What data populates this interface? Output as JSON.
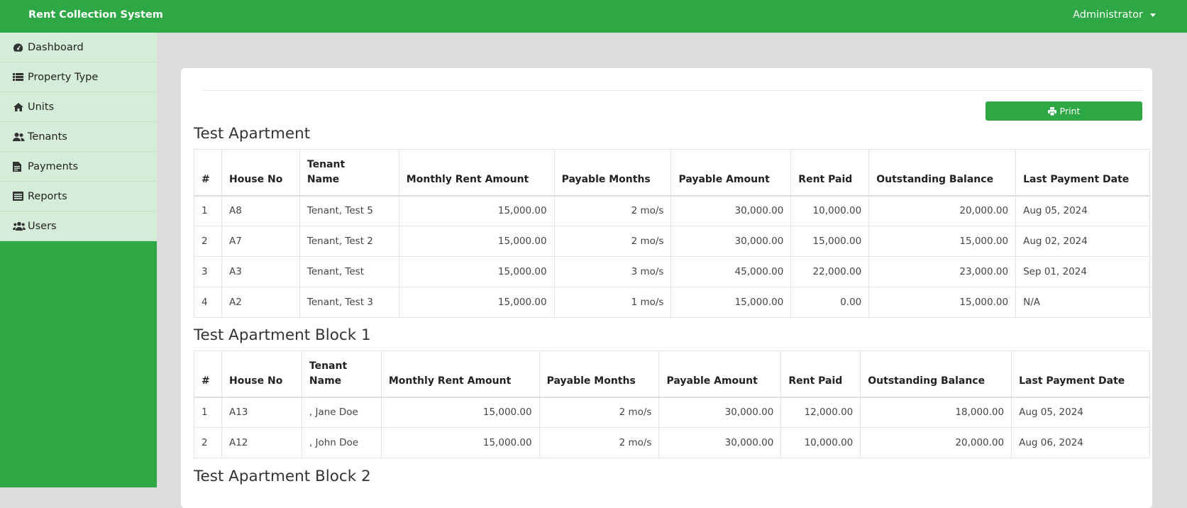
{
  "app": {
    "brand": "Rent Collection System",
    "user_label": "Administrator"
  },
  "sidebar": {
    "items": [
      {
        "label": "Dashboard",
        "icon": "dashboard-icon"
      },
      {
        "label": "Property Type",
        "icon": "list-icon"
      },
      {
        "label": "Units",
        "icon": "home-icon"
      },
      {
        "label": "Tenants",
        "icon": "user-friends-icon"
      },
      {
        "label": "Payments",
        "icon": "file-invoice-icon"
      },
      {
        "label": "Reports",
        "icon": "table-list-icon"
      },
      {
        "label": "Users",
        "icon": "users-icon"
      }
    ]
  },
  "actions": {
    "print_label": "Print"
  },
  "columns": {
    "num": "#",
    "house_no": "House No",
    "tenant_1": "Tenant",
    "tenant_2": "Name",
    "monthly_rent": "Monthly Rent Amount",
    "payable_months": "Payable Months",
    "payable_amount": "Payable Amount",
    "rent_paid": "Rent Paid",
    "outstanding": "Outstanding Balance",
    "last_payment": "Last Payment Date"
  },
  "sections": [
    {
      "title": "Test Apartment",
      "rows": [
        {
          "n": "1",
          "house": "A8",
          "tenant": "Tenant, Test 5",
          "monthly": "15,000.00",
          "months": "2 mo/s",
          "payable": "30,000.00",
          "paid": "10,000.00",
          "outstanding": "20,000.00",
          "last": "Aug 05, 2024"
        },
        {
          "n": "2",
          "house": "A7",
          "tenant": "Tenant, Test 2",
          "monthly": "15,000.00",
          "months": "2 mo/s",
          "payable": "30,000.00",
          "paid": "15,000.00",
          "outstanding": "15,000.00",
          "last": "Aug 02, 2024"
        },
        {
          "n": "3",
          "house": "A3",
          "tenant": "Tenant, Test",
          "monthly": "15,000.00",
          "months": "3 mo/s",
          "payable": "45,000.00",
          "paid": "22,000.00",
          "outstanding": "23,000.00",
          "last": "Sep 01, 2024"
        },
        {
          "n": "4",
          "house": "A2",
          "tenant": "Tenant, Test 3",
          "monthly": "15,000.00",
          "months": "1 mo/s",
          "payable": "15,000.00",
          "paid": "0.00",
          "outstanding": "15,000.00",
          "last": "N/A"
        }
      ]
    },
    {
      "title": "Test Apartment Block 1",
      "rows": [
        {
          "n": "1",
          "house": "A13",
          "tenant": ", Jane Doe",
          "monthly": "15,000.00",
          "months": "2 mo/s",
          "payable": "30,000.00",
          "paid": "12,000.00",
          "outstanding": "18,000.00",
          "last": "Aug 05, 2024"
        },
        {
          "n": "2",
          "house": "A12",
          "tenant": ", John Doe",
          "monthly": "15,000.00",
          "months": "2 mo/s",
          "payable": "30,000.00",
          "paid": "10,000.00",
          "outstanding": "20,000.00",
          "last": "Aug 06, 2024"
        }
      ]
    },
    {
      "title": "Test Apartment Block 2",
      "rows": []
    }
  ],
  "colors": {
    "primary": "#2ea844",
    "sidebar_item_bg": "#d5ecd8",
    "page_bg": "#dcdcdc"
  }
}
